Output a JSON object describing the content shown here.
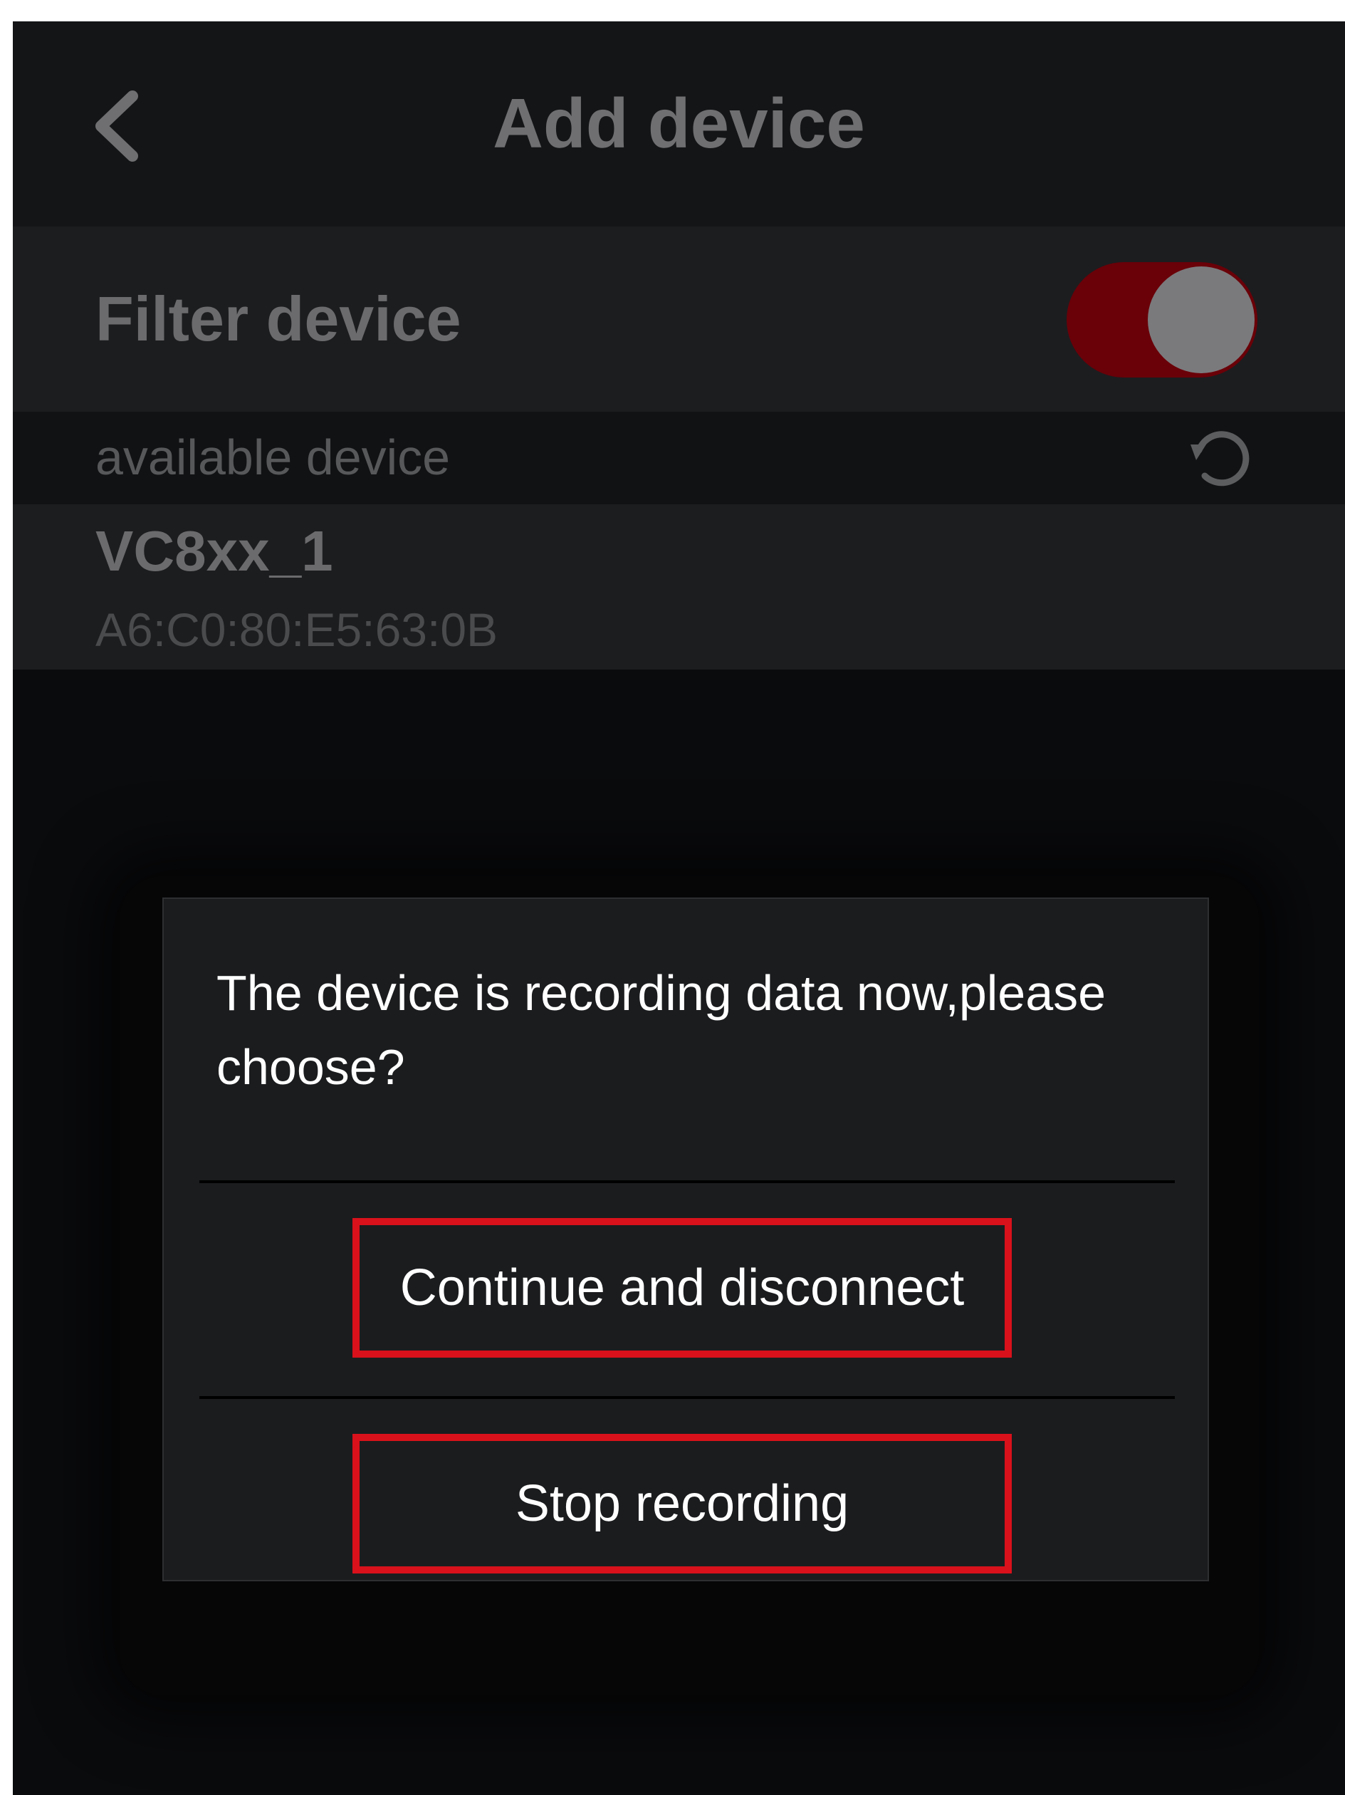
{
  "header": {
    "title": "Add device",
    "back_icon": "chevron-left-icon"
  },
  "filter": {
    "label": "Filter device",
    "enabled": true,
    "toggle_color": "#6a0008"
  },
  "section": {
    "label": "available device",
    "refresh_icon": "refresh-icon"
  },
  "devices": [
    {
      "name": "VC8xx_1",
      "mac": "A6:C0:80:E5:63:0B"
    }
  ],
  "dialog": {
    "message": "The device is recording data now,please choose?",
    "buttons": [
      {
        "label": "Continue and disconnect"
      },
      {
        "label": "Stop recording"
      }
    ],
    "highlight_color": "#d9111b"
  }
}
